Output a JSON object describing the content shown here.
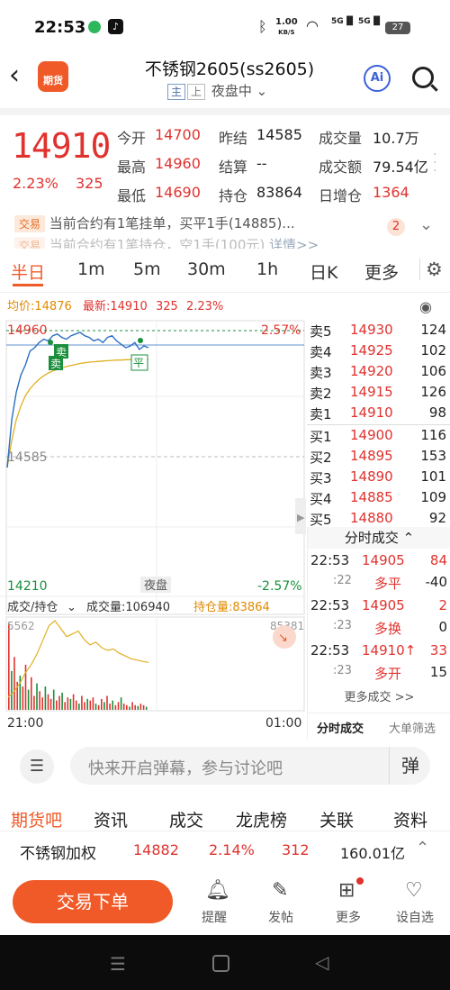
{
  "status_bar": {
    "time": "22:53",
    "net_speed_value": "1.00",
    "net_speed_unit": "KB/S",
    "signal1": "5G",
    "signal2": "5G",
    "battery": "27"
  },
  "header": {
    "title": "不锈钢2605(ss2605)",
    "tag_main": "主",
    "tag_up": "上",
    "session": "夜盘中",
    "app_badge": "期货",
    "ai_label": "Ai"
  },
  "quote": {
    "price": "14910",
    "change_pct": "2.23%",
    "change": "325",
    "open_label": "今开",
    "open": "14700",
    "prev_close_label": "昨结",
    "prev_close": "14585",
    "volume_label": "成交量",
    "volume": "10.7万",
    "high_label": "最高",
    "high": "14960",
    "settle_label": "结算",
    "settle": "--",
    "turnover_label": "成交额",
    "turnover": "79.54亿",
    "low_label": "最低",
    "low": "14690",
    "oi_label": "持仓",
    "oi": "83864",
    "oi_change_label": "日增仓",
    "oi_change": "1364"
  },
  "notices": {
    "badge1": "交易",
    "line1": "当前合约有1笔挂单，买平1手(14885)...",
    "badge2": "交易",
    "line2": "当前合约有1笔持仓，空1手(100元)",
    "line2_link": "详情>>",
    "count": "2"
  },
  "tabs": [
    "半日",
    "1m",
    "5m",
    "30m",
    "1h",
    "日K",
    "更多"
  ],
  "chart": {
    "avg_label": "均价:14876",
    "latest_label": "最新:14910",
    "latest_change": "325",
    "latest_pct": "2.23%",
    "y_top": "14960",
    "y_top_pct": "2.57%",
    "y_mid": "14585",
    "y_bottom": "14210",
    "y_bottom_pct": "-2.57%",
    "session_label": "夜盘",
    "marker_sell": "卖",
    "marker_close": "平",
    "volume_tab": "成交/持仓",
    "volume_text": "成交量:106940",
    "oi_text": "持仓量:83864",
    "vol_max": "5562",
    "oi_max": "85381",
    "time_start": "21:00",
    "time_end": "01:00",
    "price_series": [
      14560,
      14700,
      14780,
      14830,
      14860,
      14900,
      14910,
      14925,
      14935,
      14930,
      14945,
      14950,
      14940,
      14935,
      14945,
      14950,
      14955,
      14945,
      14940,
      14930,
      14935,
      14925,
      14940,
      14945,
      14930,
      14920,
      14910,
      14915,
      14925,
      14905,
      14915,
      14910
    ],
    "avg_series": [
      14560,
      14640,
      14700,
      14740,
      14770,
      14790,
      14805,
      14818,
      14828,
      14836,
      14842,
      14847,
      14851,
      14855,
      14858,
      14861,
      14864,
      14866,
      14868,
      14869,
      14870,
      14871,
      14872,
      14873,
      14874,
      14874,
      14875,
      14875,
      14876,
      14876,
      14876,
      14876
    ],
    "oi_series": [
      82600,
      82800,
      83100,
      83500,
      83800,
      84200,
      84700,
      85200,
      85381,
      85100,
      84800,
      84900,
      85000,
      84700,
      84500,
      84600,
      84400,
      84300,
      84350,
      84200,
      84100,
      84000,
      83950,
      83900,
      83864
    ],
    "vol_series": [
      5562,
      2500,
      3400,
      1800,
      2200,
      1500,
      2900,
      1300,
      2100,
      900,
      1700,
      1200,
      800,
      1500,
      1000,
      700,
      1300,
      600,
      900,
      1100,
      500,
      800,
      700,
      1000,
      600,
      400,
      900,
      500,
      700,
      600,
      800,
      400,
      300,
      700,
      500,
      900,
      400,
      600,
      300,
      500,
      800,
      400,
      300,
      200,
      500,
      300,
      250,
      400,
      300,
      200
    ]
  },
  "order_book": {
    "asks": [
      {
        "label": "卖5",
        "price": "14930",
        "vol": "124"
      },
      {
        "label": "卖4",
        "price": "14925",
        "vol": "102"
      },
      {
        "label": "卖3",
        "price": "14920",
        "vol": "106"
      },
      {
        "label": "卖2",
        "price": "14915",
        "vol": "126"
      },
      {
        "label": "卖1",
        "price": "14910",
        "vol": "98"
      }
    ],
    "bids": [
      {
        "label": "买1",
        "price": "14900",
        "vol": "116"
      },
      {
        "label": "买2",
        "price": "14895",
        "vol": "153"
      },
      {
        "label": "买3",
        "price": "14890",
        "vol": "101"
      },
      {
        "label": "买4",
        "price": "14885",
        "vol": "109"
      },
      {
        "label": "买5",
        "price": "14880",
        "vol": "92"
      }
    ],
    "ticks_title": "分时成交",
    "ticks": [
      {
        "time": "22:53",
        "sec": ":22",
        "price": "14905",
        "vol": "84",
        "type": "多平",
        "oi": "-40"
      },
      {
        "time": "22:53",
        "sec": ":23",
        "price": "14905",
        "vol": "2",
        "type": "多换",
        "oi": "0"
      },
      {
        "time": "22:53",
        "sec": ":23",
        "price": "14910↑",
        "vol": "33",
        "type": "多开",
        "oi": "15"
      }
    ],
    "more_ticks": "更多成交 >>",
    "tab_ticks": "分时成交",
    "tab_big": "大单筛选"
  },
  "comment": {
    "placeholder": "快来开启弹幕，参与讨论吧",
    "danmu": "弹"
  },
  "nav_tabs": [
    "期货吧",
    "资讯",
    "成交",
    "龙虎榜",
    "关联",
    "资料"
  ],
  "foot": {
    "name": "不锈钢加权",
    "price": "14882",
    "pct": "2.14%",
    "change": "312",
    "turnover": "160.01亿"
  },
  "actions": {
    "trade": "交易下单",
    "alert": "提醒",
    "post": "发帖",
    "more": "更多",
    "custom": "设自选"
  },
  "colors": {
    "up": "#e0322e",
    "down": "#1a8f3c",
    "accent": "#f05a28",
    "avg_line": "#e0b020",
    "price_line": "#2a6fc2"
  }
}
